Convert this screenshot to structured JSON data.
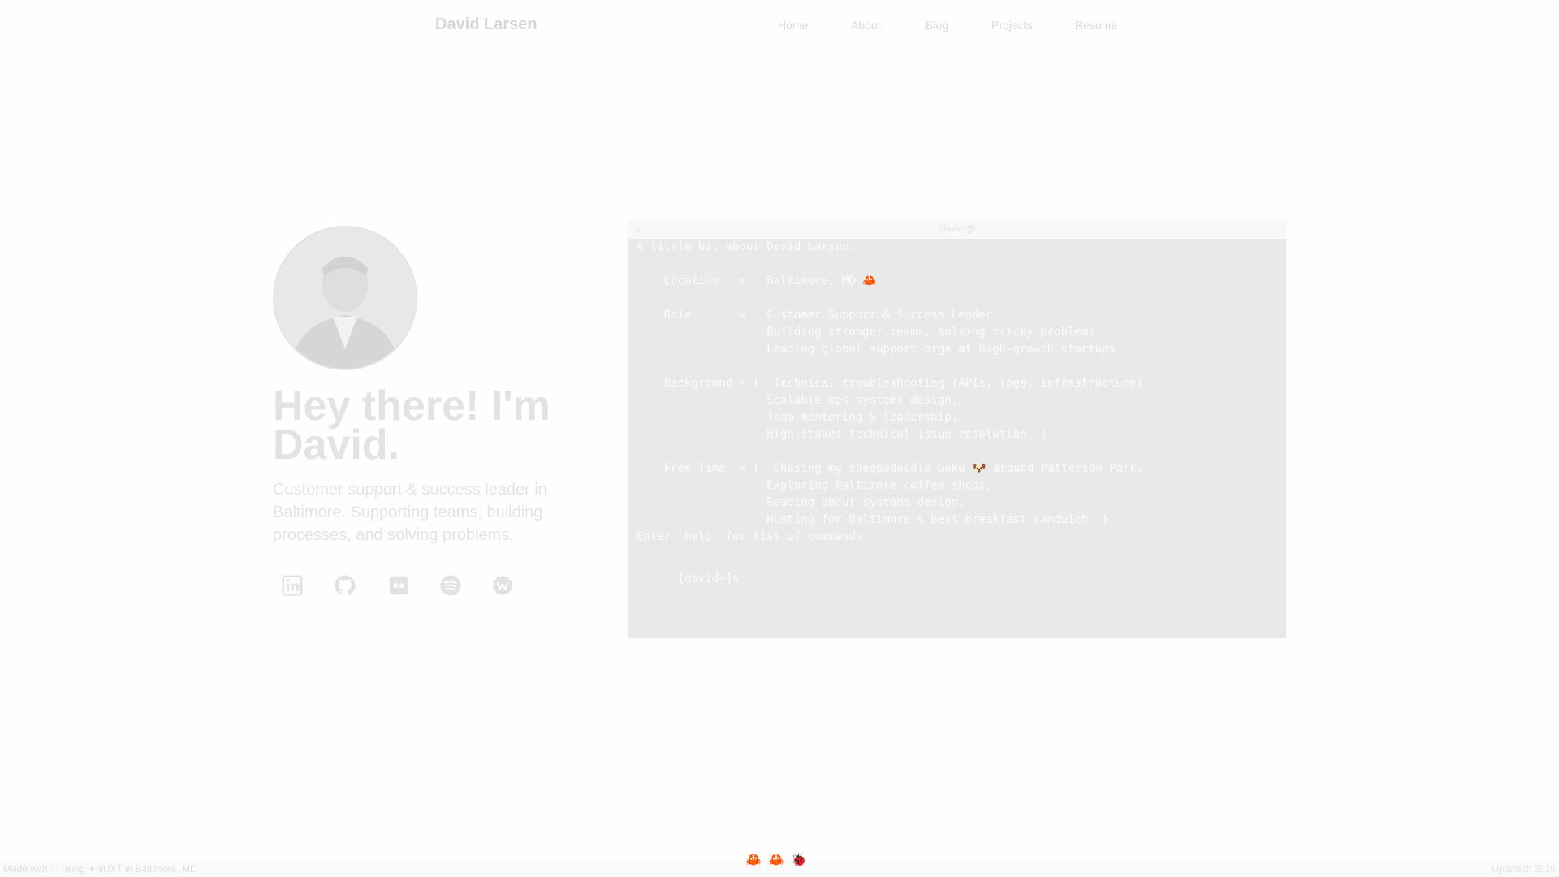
{
  "nav": {
    "brand": "David Larsen",
    "items": [
      "Home",
      "About",
      "Blog",
      "Projects",
      "Resume"
    ]
  },
  "hero": {
    "title": "Hey there! I'm David.",
    "subtitle": "Customer support & success leader in Baltimore. Supporting teams, building processes, and solving problems."
  },
  "social": [
    "linkedin-icon",
    "github-icon",
    "flickr-icon",
    "spotify-icon",
    "wordpress-icon"
  ],
  "terminal": {
    "title": "[david~]$",
    "lines": [
      "A little bit about David Larsen:",
      "",
      "    Location   =   Baltimore, MD 🦀",
      "",
      "    Role       =   Customer Support & Success Leader",
      "                   Building stronger teams, solving tricky problems",
      "                   Leading global support orgs at high-growth startups",
      "",
      "    Background = {  Technical troubleshooting (APIs, logs, infrastructure),",
      "                   Scalable ops systems design,",
      "                   Team mentoring & leadership,",
      "                   High-stakes technical issue resolution  }",
      "",
      "    Free Time  = {  Chasing my sheepadoodle Goku 🐶 around Patterson Park,",
      "                   Exploring Baltimore coffee shops,",
      "                   Reading about systems design,",
      "                   Hunting for Baltimore's best breakfast sandwich  }"
    ],
    "help": "Enter 'help' for list of commands",
    "prompt": "[david~]$"
  },
  "footer": {
    "left": "Made with ♡ using ✈NUXT in Baltimore, MD",
    "center": "🦀🦀🐞",
    "right": "Updated: 2025"
  },
  "colors": {
    "accent": "#d84315",
    "terminal_bg": "#e9e9e9"
  }
}
